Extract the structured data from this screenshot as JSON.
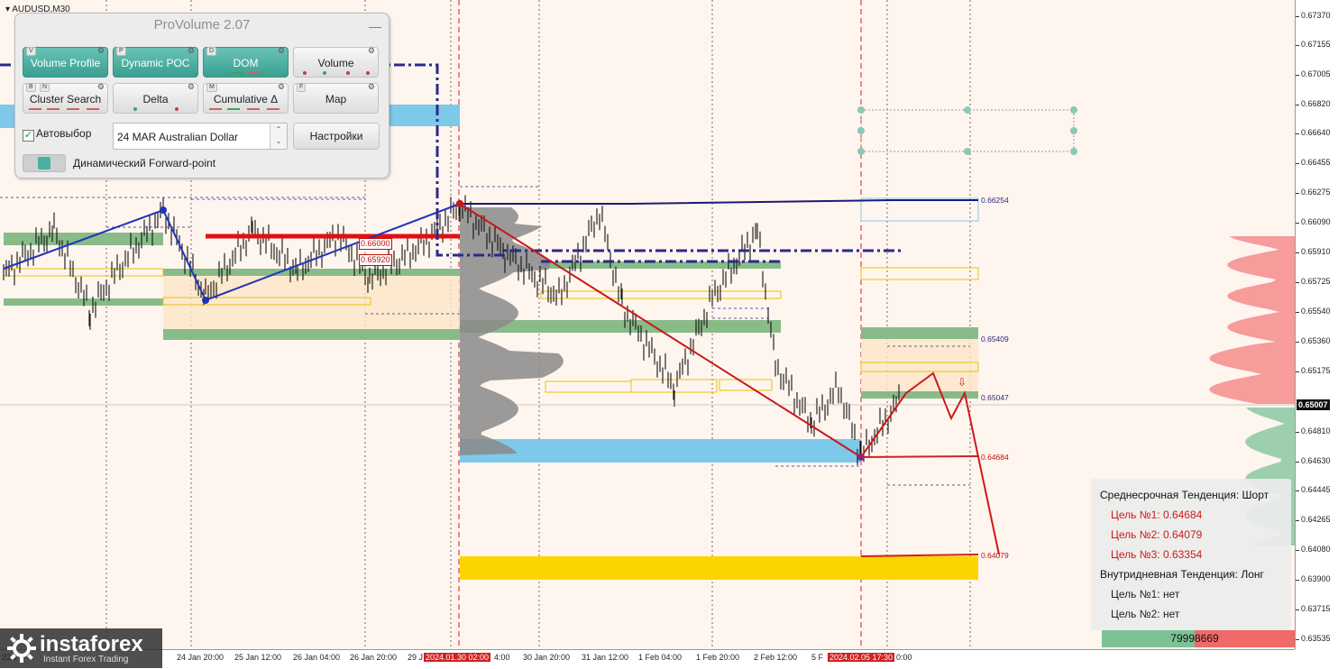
{
  "symbol": "AUDUSD,M30",
  "price_axis": [
    "0.67370",
    "0.67155",
    "0.67005",
    "0.66820",
    "0.66640",
    "0.66455",
    "0.66275",
    "0.66090",
    "0.65910",
    "0.65725",
    "0.65540",
    "0.65360",
    "0.65175",
    "0.65007",
    "0.64810",
    "0.64630",
    "0.64445",
    "0.64265",
    "0.64080",
    "0.63900",
    "0.63715",
    "0.63535"
  ],
  "current_price": "0.65007",
  "time_axis": [
    "22 J",
    "24 Jan 20:00",
    "25 Jan 12:00",
    "26 Jan 04:00",
    "26 Jan 20:00",
    "29 J",
    "2024.01.30 02:00",
    "4:00",
    "30 Jan 20:00",
    "31 Jan 12:00",
    "1 Feb 04:00",
    "1 Feb 20:00",
    "2 Feb 12:00",
    "5 F",
    "2024.02.05 17:30",
    "0:00"
  ],
  "level_labels": {
    "l1": "0.66254",
    "l2": "0.65409",
    "l3": "0.65047",
    "l4": "0.64684",
    "l5": "0.64079",
    "tag1": "0.66000",
    "tag2": "0.65920"
  },
  "panel": {
    "title": "ProVolume 2.07",
    "minimize": "—",
    "buttons": [
      {
        "label": "Volume Profile",
        "key": "V",
        "active": true
      },
      {
        "label": "Dynamic POC",
        "key": "P",
        "active": true
      },
      {
        "label": "DOM",
        "key": "D",
        "active": true
      },
      {
        "label": "Volume",
        "key": "",
        "active": false
      },
      {
        "label": "Cluster Search",
        "key": "B",
        "key2": "N",
        "active": false
      },
      {
        "label": "Delta",
        "key": "",
        "active": false
      },
      {
        "label": "Cumulative Δ",
        "key": "M",
        "active": false
      },
      {
        "label": "Map",
        "key": "F",
        "active": false
      }
    ],
    "auto_select_label": "Автовыбор",
    "auto_select_checked": true,
    "instrument_value": "24 MAR Australian Dollar",
    "settings_label": "Настройки",
    "forward_label": "Динамический Forward-point",
    "accent_color": "#49b0a3"
  },
  "trend": {
    "mid_title": "Среднесрочная Тенденция: Шорт",
    "mid_targets": [
      "Цель №1: 0.64684",
      "Цель №2: 0.64079",
      "Цель №3: 0.63354"
    ],
    "intra_title": "Внутридневная Тенденция: Лонг",
    "intra_targets": [
      "Цель №1: нет",
      "Цель №2: нет"
    ]
  },
  "volume_counter": {
    "buy": "7999",
    "sell": "8669"
  },
  "logo": {
    "name": "instaforex",
    "tagline": "Instant Forex Trading"
  }
}
